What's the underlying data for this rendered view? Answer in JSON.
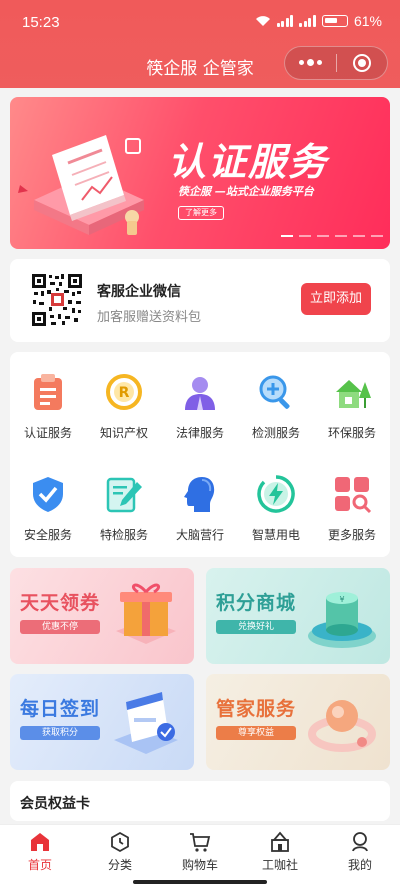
{
  "status": {
    "time": "15:23",
    "battery": "61%"
  },
  "header": {
    "title": "筷企服 企管家"
  },
  "banner": {
    "title": "认证服务",
    "subtitle": "筷企服 —站式企业服务平台",
    "button": "了解更多",
    "page_count": 6,
    "active_page": 1
  },
  "wechat": {
    "title": "客服企业微信",
    "subtitle": "加客服赠送资料包",
    "button": "立即添加"
  },
  "services": [
    {
      "label": "认证服务",
      "icon": "clipboard-icon"
    },
    {
      "label": "知识产权",
      "icon": "registered-icon"
    },
    {
      "label": "法律服务",
      "icon": "lawyer-icon"
    },
    {
      "label": "检测服务",
      "icon": "magnifier-plus-icon"
    },
    {
      "label": "环保服务",
      "icon": "green-house-icon"
    },
    {
      "label": "安全服务",
      "icon": "shield-check-icon"
    },
    {
      "label": "特检服务",
      "icon": "pen-document-icon"
    },
    {
      "label": "大脑营行",
      "icon": "head-profile-icon"
    },
    {
      "label": "智慧用电",
      "icon": "lightning-icon"
    },
    {
      "label": "更多服务",
      "icon": "grid-search-icon"
    }
  ],
  "promos": [
    {
      "title": "天天领券",
      "badge": "优惠不停",
      "color": "#e8525f",
      "bg": "#fbd3d8"
    },
    {
      "title": "积分商城",
      "badge": "兑换好礼",
      "color": "#2e9f96",
      "bg": "#c9ece7"
    },
    {
      "title": "每日签到",
      "badge": "获取积分",
      "color": "#3b7ae0",
      "bg": "#d6e4f8"
    },
    {
      "title": "管家服务",
      "badge": "尊享权益",
      "color": "#e8713b",
      "bg": "#f2e8d8"
    }
  ],
  "member": {
    "title": "会员权益卡"
  },
  "tabs": [
    {
      "label": "首页",
      "icon": "home-icon",
      "active": true
    },
    {
      "label": "分类",
      "icon": "compass-icon",
      "active": false
    },
    {
      "label": "购物车",
      "icon": "cart-icon",
      "active": false
    },
    {
      "label": "工咖社",
      "icon": "building-icon",
      "active": false
    },
    {
      "label": "我的",
      "icon": "user-icon",
      "active": false
    }
  ],
  "colors": {
    "brand": "#f05a5a",
    "accent": "#f0444c",
    "tab_active": "#e8343a"
  }
}
